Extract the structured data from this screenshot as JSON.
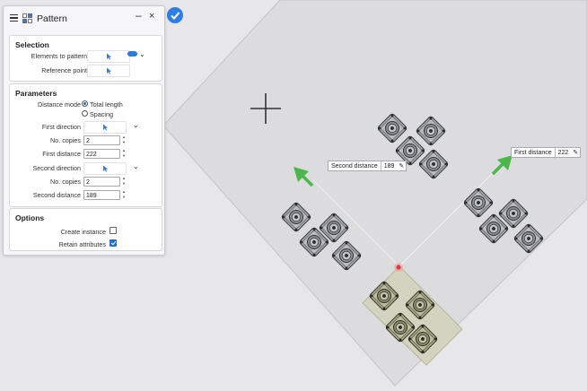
{
  "panel": {
    "title": "Pattern",
    "minimize": "–",
    "close": "×"
  },
  "selection": {
    "heading": "Selection",
    "elements_label": "Elements to pattern",
    "reference_label": "Reference point"
  },
  "parameters": {
    "heading": "Parameters",
    "distance_mode_label": "Distance mode",
    "mode_total": "Total length",
    "mode_spacing": "Spacing",
    "first_direction_label": "First direction",
    "copies1_label": "No. copies",
    "copies1_value": "2",
    "first_distance_label": "First distance",
    "first_distance_value": "222",
    "second_direction_label": "Second direction",
    "copies2_label": "No. copies",
    "copies2_value": "2",
    "second_distance_label": "Second distance",
    "second_distance_value": "189"
  },
  "options": {
    "heading": "Options",
    "create_instance_label": "Create instance",
    "retain_attributes_label": "Retain attributes"
  },
  "callouts": {
    "second_label": "Second distance",
    "second_value": "189",
    "first_label": "First distance",
    "first_value": "222"
  },
  "colors": {
    "accent": "#2f7ee6",
    "arrow": "#4cb84c",
    "selected_part": "#a9a98a",
    "part": "#9a9ca3",
    "anchor": "#e23b3b"
  }
}
